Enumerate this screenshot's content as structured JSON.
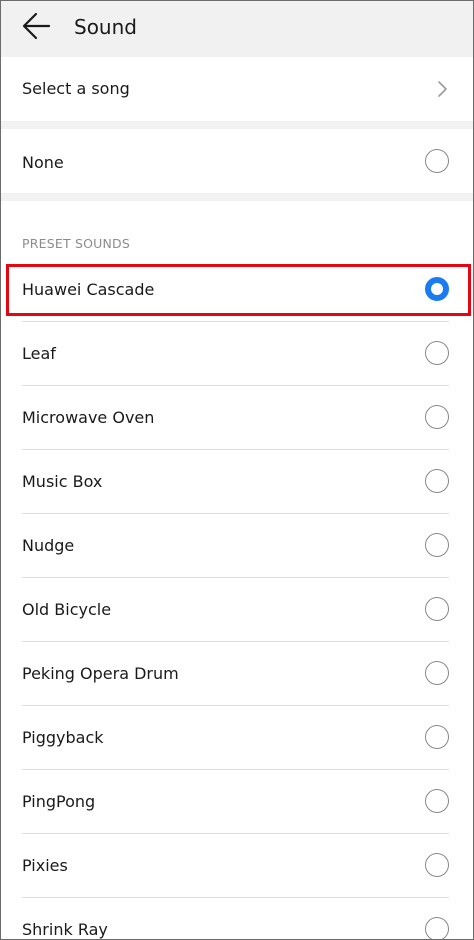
{
  "header": {
    "title": "Sound"
  },
  "select_song": {
    "label": "Select a song"
  },
  "none_option": {
    "label": "None",
    "selected": false
  },
  "preset": {
    "section_label": "PRESET SOUNDS",
    "items": [
      {
        "label": "Huawei Cascade",
        "selected": true
      },
      {
        "label": "Leaf",
        "selected": false
      },
      {
        "label": "Microwave Oven",
        "selected": false
      },
      {
        "label": "Music Box",
        "selected": false
      },
      {
        "label": "Nudge",
        "selected": false
      },
      {
        "label": "Old Bicycle",
        "selected": false
      },
      {
        "label": "Peking Opera Drum",
        "selected": false
      },
      {
        "label": "Piggyback",
        "selected": false
      },
      {
        "label": "PingPong",
        "selected": false
      },
      {
        "label": "Pixies",
        "selected": false
      },
      {
        "label": "Shrink Ray",
        "selected": false
      }
    ]
  },
  "colors": {
    "accent": "#1a7cf0",
    "highlight": "#e30613",
    "background": "#f1f1f1"
  }
}
